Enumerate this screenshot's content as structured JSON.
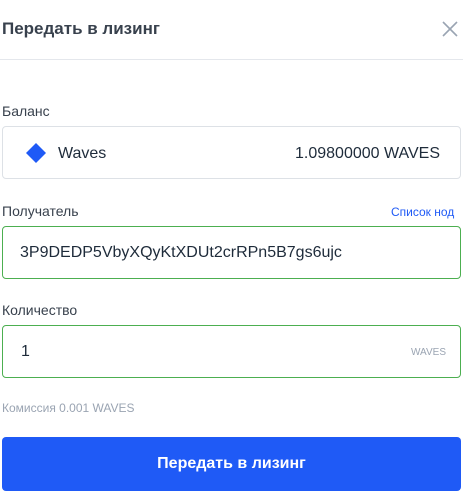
{
  "dialog": {
    "title": "Передать в лизинг",
    "close_icon": "close-icon"
  },
  "balance": {
    "label": "Баланс",
    "asset_icon": "waves-diamond-icon",
    "asset_name": "Waves",
    "amount": "1.09800000 WAVES"
  },
  "recipient": {
    "label": "Получатель",
    "node_list_link": "Список нод",
    "value": "3P9DEDP5VbyXQyKtXDUt2crRPn5B7gs6ujc"
  },
  "quantity": {
    "label": "Количество",
    "value": "1",
    "unit": "WAVES"
  },
  "fee": "Комиссия 0.001 WAVES",
  "submit_label": "Передать в лизинг",
  "colors": {
    "accent": "#1f5af6",
    "valid_border": "#4caf50",
    "asset_icon": "#1f5af6"
  }
}
